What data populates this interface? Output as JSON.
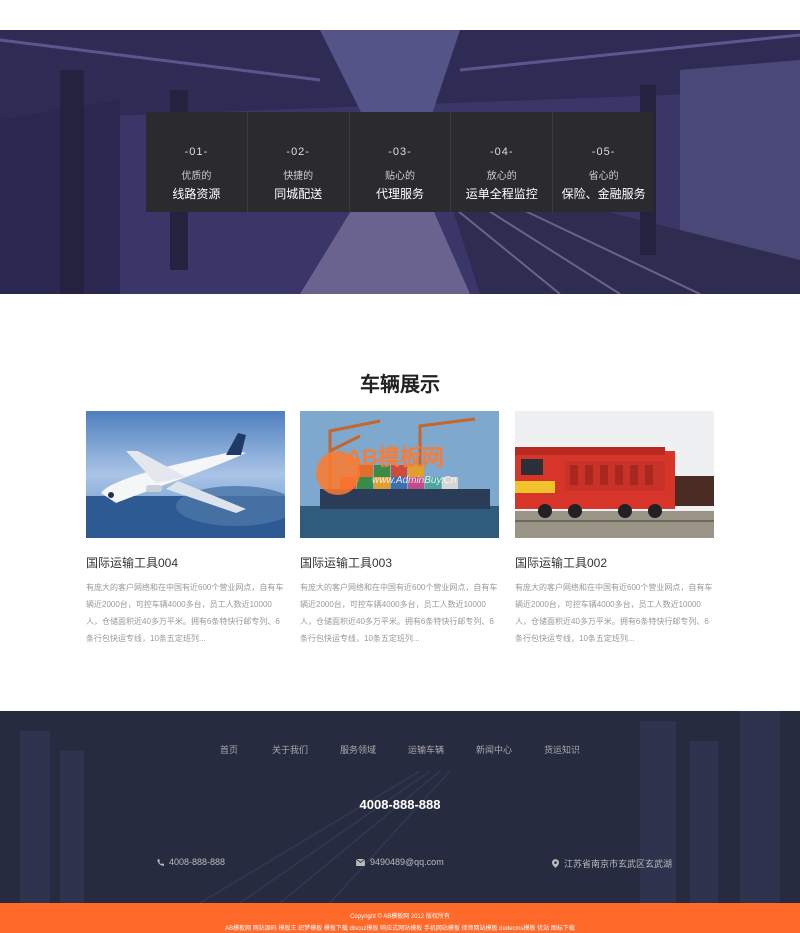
{
  "features": [
    {
      "num": "-01-",
      "small": "优质的",
      "big": "线路资源"
    },
    {
      "num": "-02-",
      "small": "快捷的",
      "big": "同城配送"
    },
    {
      "num": "-03-",
      "small": "贴心的",
      "big": "代理服务"
    },
    {
      "num": "-04-",
      "small": "放心的",
      "big": "运单全程监控"
    },
    {
      "num": "-05-",
      "small": "省心的",
      "big": "保险、金融服务"
    }
  ],
  "products": {
    "title": "车辆展示",
    "items": [
      {
        "title": "国际运输工具004",
        "desc": "有庞大的客户网络和在中国有近600个营业网点，自有车辆近2000台，可控车辆4000多台，员工人数近10000人，仓储面积近40多万平米。拥有6条特快行邮专列、6条行包快运专线，10条五定班列..."
      },
      {
        "title": "国际运输工具003",
        "desc": "有庞大的客户网络和在中国有近600个营业网点，自有车辆近2000台，可控车辆4000多台，员工人数近10000人，仓储面积近40多万平米。拥有6条特快行邮专列、6条行包快运专线，10条五定班列..."
      },
      {
        "title": "国际运输工具002",
        "desc": "有庞大的客户网络和在中国有近600个营业网点，自有车辆近2000台，可控车辆4000多台，员工人数近10000人，仓储面积近40多万平米。拥有6条特快行邮专列、6条行包快运专线，10条五定班列..."
      }
    ],
    "watermark": "AB模板网",
    "watermark_url": "www.AdminBuy.Cn"
  },
  "footer": {
    "nav": [
      "首页",
      "关于我们",
      "服务领域",
      "运输车辆",
      "新闻中心",
      "货运知识"
    ],
    "hotline": "4008-888-888",
    "phone": "4008-888-888",
    "email": "9490489@qq.com",
    "address": "江苏省南京市玄武区玄武湖"
  },
  "bottom": {
    "copyright": "Copyright © AB模板网 2012 版权所有",
    "links": "AB模板网 网站源码 模板王 织梦模板 模板下载 discuz模板 响应式网站模板 手机网站模板 律师网站模板 dedecms模板 优站 图标下载"
  },
  "colors": {
    "accent": "#ff6a2b",
    "footer_bg": "#262a3f",
    "hero_tint": "#302c5c",
    "feature_bg": "#2b2b2f"
  }
}
